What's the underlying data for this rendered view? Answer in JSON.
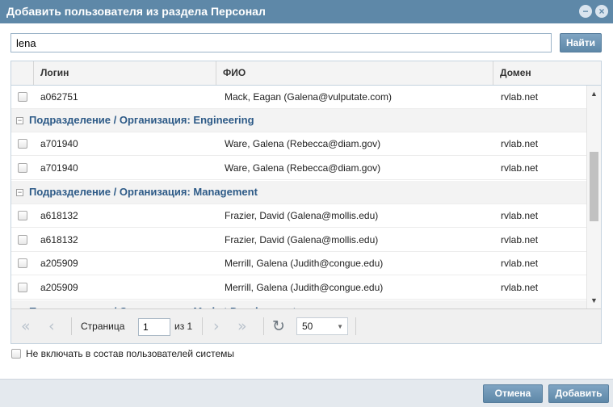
{
  "dialog": {
    "title": "Добавить пользователя из раздела Персонал",
    "minimize_icon": "minimize-icon",
    "close_icon": "close-icon"
  },
  "search": {
    "value": "lena",
    "button_label": "Найти"
  },
  "grid": {
    "columns": {
      "login": "Логин",
      "fio": "ФИО",
      "domain": "Домен"
    },
    "rows": [
      {
        "type": "user",
        "login": "a062751",
        "fio": "Mack, Eagan (Galena@vulputate.com)",
        "domain": "rvlab.net"
      },
      {
        "type": "group",
        "label": "Подразделение / Организация: Engineering"
      },
      {
        "type": "user",
        "login": "a701940",
        "fio": "Ware, Galena (Rebecca@diam.gov)",
        "domain": "rvlab.net"
      },
      {
        "type": "user",
        "login": "a701940",
        "fio": "Ware, Galena (Rebecca@diam.gov)",
        "domain": "rvlab.net"
      },
      {
        "type": "group",
        "label": "Подразделение / Организация: Management"
      },
      {
        "type": "user",
        "login": "a618132",
        "fio": "Frazier, David (Galena@mollis.edu)",
        "domain": "rvlab.net"
      },
      {
        "type": "user",
        "login": "a618132",
        "fio": "Frazier, David (Galena@mollis.edu)",
        "domain": "rvlab.net"
      },
      {
        "type": "user",
        "login": "a205909",
        "fio": "Merrill, Galena (Judith@congue.edu)",
        "domain": "rvlab.net"
      },
      {
        "type": "user",
        "login": "a205909",
        "fio": "Merrill, Galena (Judith@congue.edu)",
        "domain": "rvlab.net"
      },
      {
        "type": "group",
        "label": "Подразделение / Организация: Market Development"
      }
    ]
  },
  "pager": {
    "page_label": "Страница",
    "page_value": "1",
    "of_label": "из 1",
    "page_size": "50"
  },
  "exclude_checkbox_label": "Не включать в состав пользователей системы",
  "footer": {
    "cancel_label": "Отмена",
    "add_label": "Добавить"
  }
}
